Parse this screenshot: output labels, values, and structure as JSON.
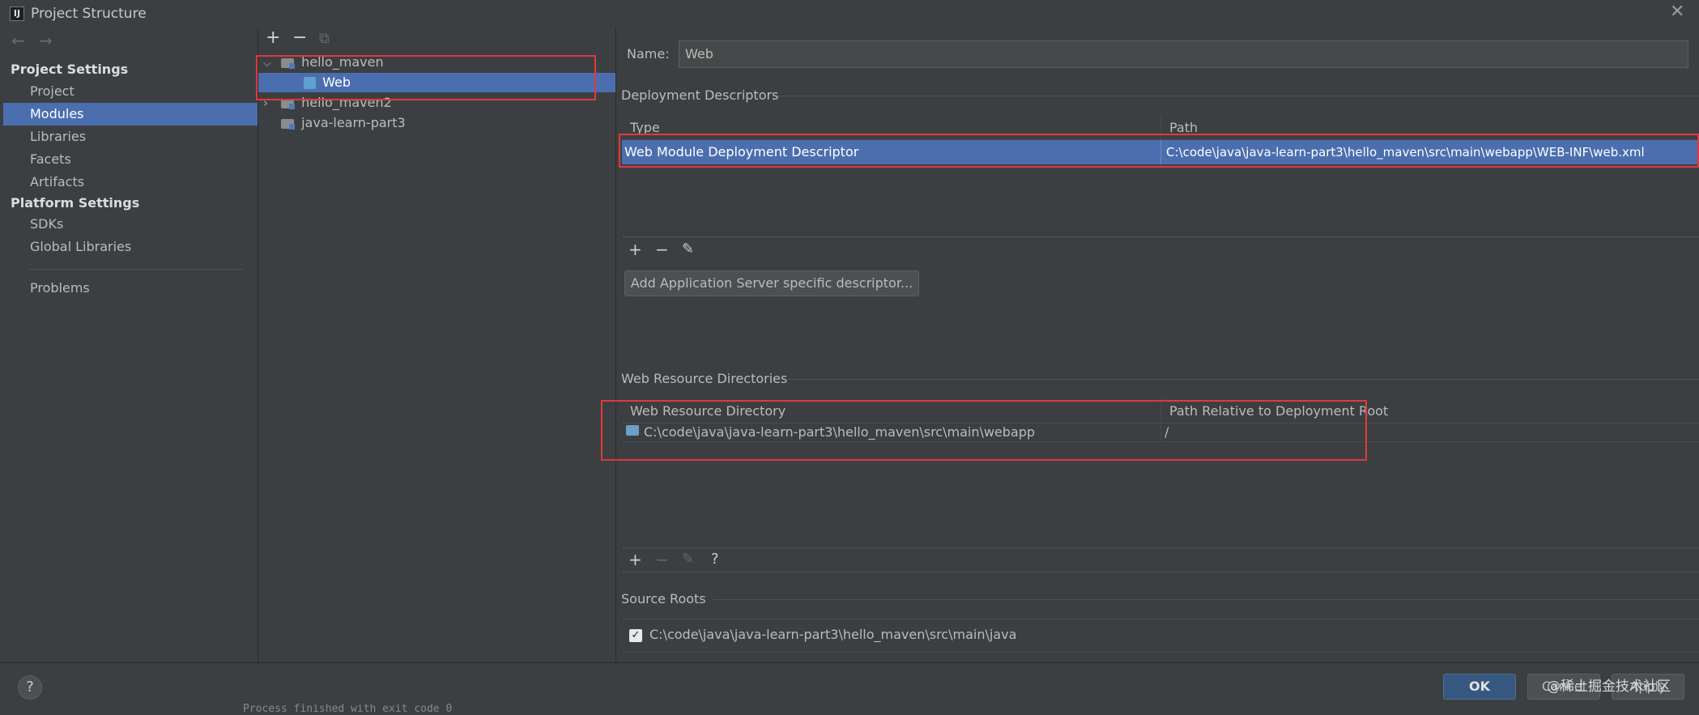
{
  "window": {
    "title": "Project Structure",
    "close_icon": "close-icon"
  },
  "sidebar": {
    "back_icon": "←",
    "forward_icon": "→",
    "project_settings_header": "Project Settings",
    "platform_settings_header": "Platform Settings",
    "items": [
      {
        "label": "Project",
        "selected": false
      },
      {
        "label": "Modules",
        "selected": true
      },
      {
        "label": "Libraries",
        "selected": false
      },
      {
        "label": "Facets",
        "selected": false
      },
      {
        "label": "Artifacts",
        "selected": false
      },
      {
        "label": "SDKs",
        "selected": false
      },
      {
        "label": "Global Libraries",
        "selected": false
      },
      {
        "label": "Problems",
        "selected": false
      }
    ]
  },
  "tree": {
    "toolbar": {
      "add": "+",
      "remove": "−",
      "copy": "⧉"
    },
    "nodes": [
      {
        "label": "hello_maven",
        "expanded": true
      },
      {
        "label": "Web",
        "selected": true
      },
      {
        "label": "hello_maven2",
        "expanded": false
      },
      {
        "label": "java-learn-part3"
      }
    ]
  },
  "detail": {
    "name_label": "Name:",
    "name_value": "Web",
    "deployment_descriptors": {
      "title": "Deployment Descriptors",
      "columns": [
        "Type",
        "Path"
      ],
      "rows": [
        {
          "type": "Web Module Deployment Descriptor",
          "path": "C:\\code\\java\\java-learn-part3\\hello_maven\\src\\main\\webapp\\WEB-INF\\web.xml"
        }
      ],
      "add_server_descriptor_button": "Add Application Server specific descriptor..."
    },
    "web_resource_directories": {
      "title": "Web Resource Directories",
      "columns": [
        "Web Resource Directory",
        "Path Relative to Deployment Root"
      ],
      "rows": [
        {
          "directory": "C:\\code\\java\\java-learn-part3\\hello_maven\\src\\main\\webapp",
          "relative_path": "/"
        }
      ],
      "help": "?"
    },
    "source_roots": {
      "title": "Source Roots",
      "items": [
        {
          "checked": true,
          "path": "C:\\code\\java\\java-learn-part3\\hello_maven\\src\\main\\java"
        }
      ]
    }
  },
  "footer": {
    "help": "?",
    "ok": "OK",
    "cancel": "Cancel",
    "apply": "Apply",
    "watermark": "@稀土掘金技术社区"
  },
  "background_text": "Process finished with exit code 0",
  "colors": {
    "selection": "#4b6eaf",
    "highlight_border": "#e0393e",
    "panel": "#3c3f41"
  }
}
